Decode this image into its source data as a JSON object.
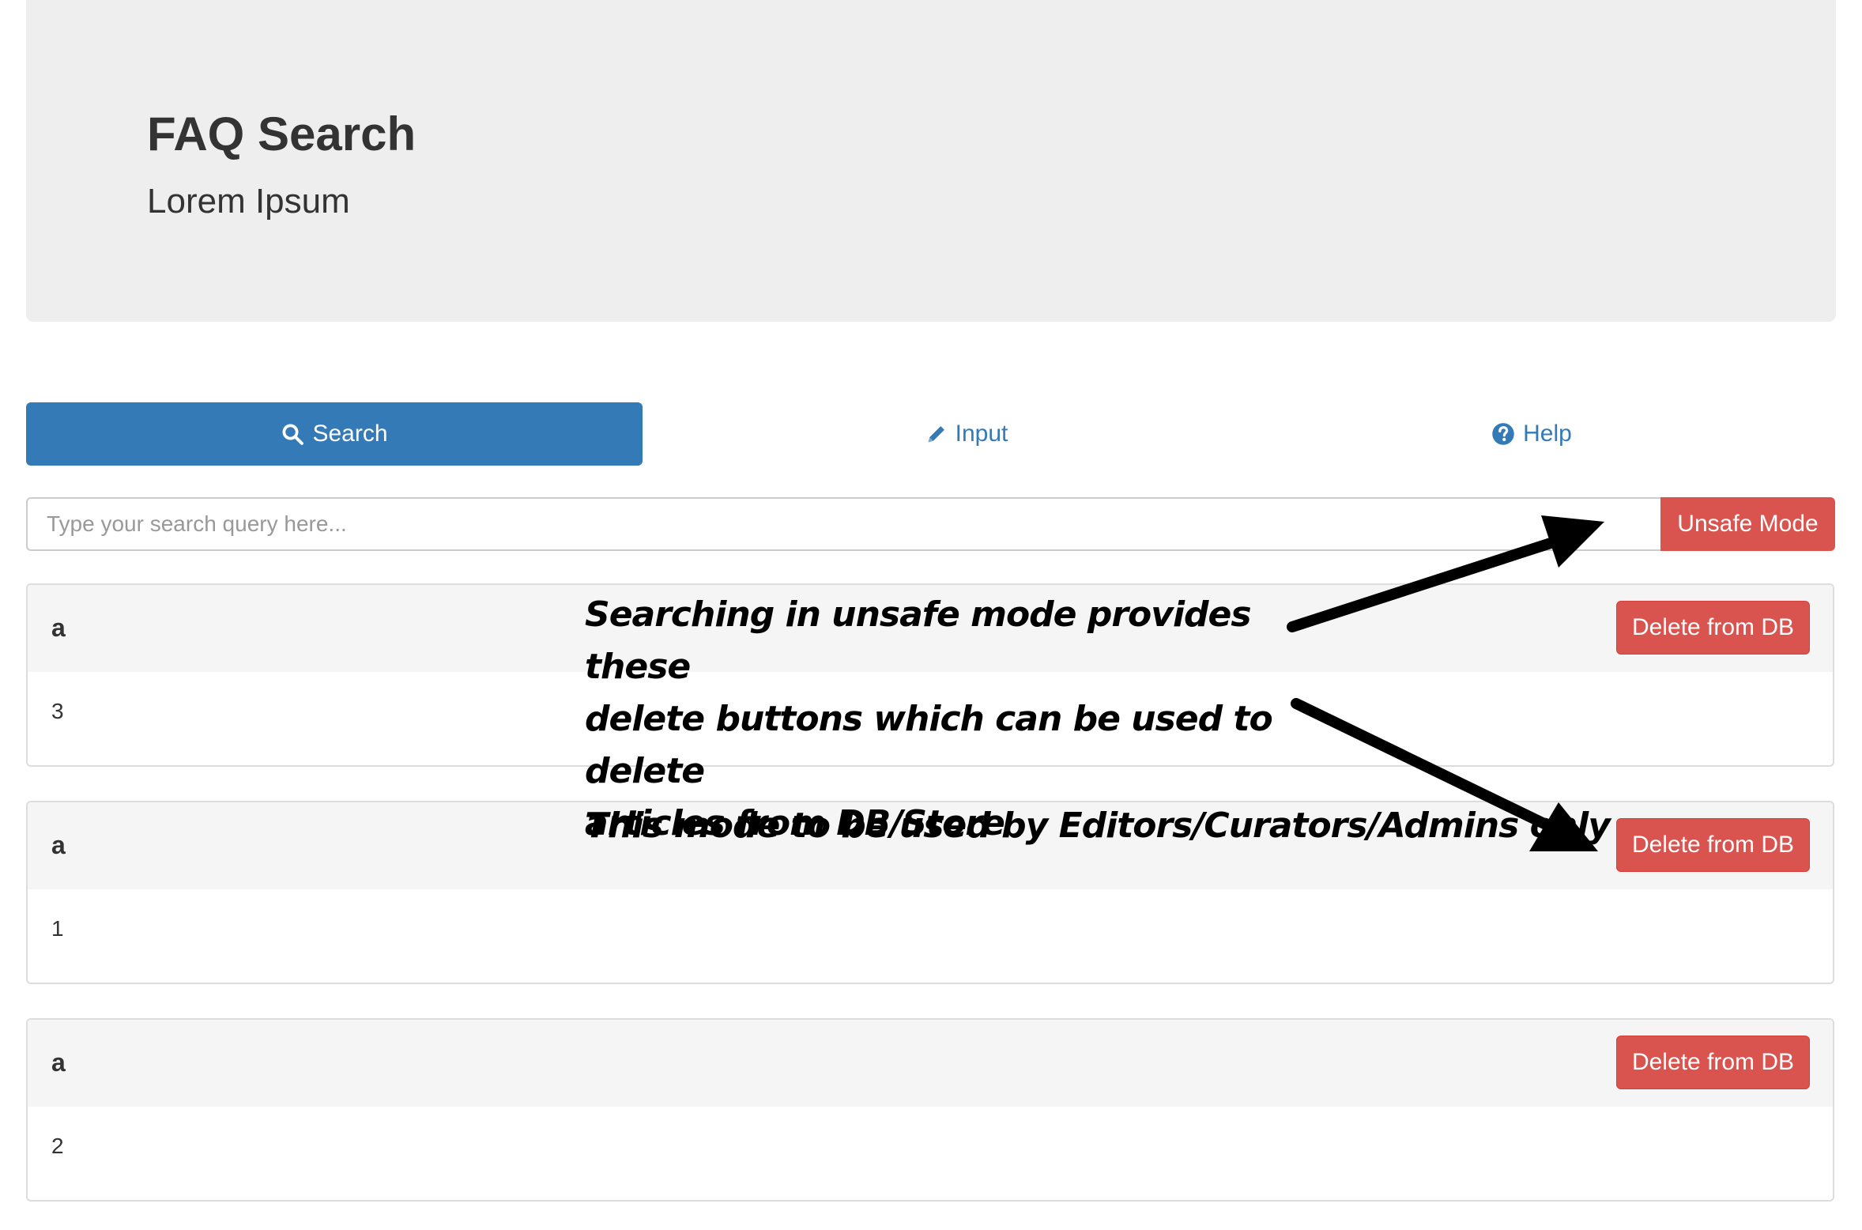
{
  "header": {
    "title": "FAQ Search",
    "subtitle": "Lorem Ipsum"
  },
  "tabs": [
    {
      "label": "Search",
      "icon": "search-icon",
      "active": true
    },
    {
      "label": "Input",
      "icon": "pencil-icon",
      "active": false
    },
    {
      "label": "Help",
      "icon": "question-circle-icon",
      "active": false
    }
  ],
  "search": {
    "placeholder": "Type your search query here...",
    "value": "",
    "unsafe_mode_label": "Unsafe Mode"
  },
  "results": [
    {
      "title": "a",
      "body": "3",
      "delete_label": "Delete from DB"
    },
    {
      "title": "a",
      "body": "1",
      "delete_label": "Delete from DB"
    },
    {
      "title": "a",
      "body": "2",
      "delete_label": "Delete from DB"
    }
  ],
  "annotations": {
    "note_lines": [
      "Searching in unsafe mode provides these",
      "delete buttons which can be used to delete",
      "articles from DB/Store"
    ],
    "note_admins": "This mode to be used by Editors/Curators/Admins only"
  },
  "colors": {
    "primary": "#337ab7",
    "danger": "#d9534f",
    "jumbotron_bg": "#eeeeee",
    "panel_heading_bg": "#f5f5f5"
  }
}
